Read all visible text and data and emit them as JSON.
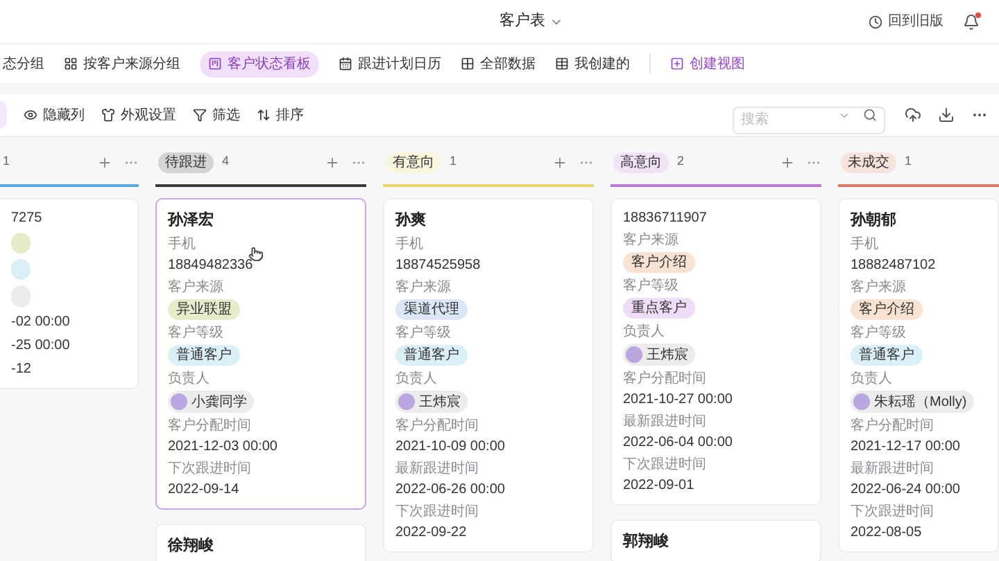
{
  "header": {
    "title": "客户表",
    "back_label": "回到旧版",
    "notification": true
  },
  "views": [
    {
      "label": "态分组",
      "selected": false
    },
    {
      "label": "按客户来源分组",
      "selected": false
    },
    {
      "label": "客户状态看板",
      "selected": true
    },
    {
      "label": "跟进计划日历",
      "selected": false
    },
    {
      "label": "全部数据",
      "selected": false
    },
    {
      "label": "我创建的",
      "selected": false
    }
  ],
  "create_view": "创建视图",
  "toolbar": [
    "隐藏列",
    "外观设置",
    "筛选",
    "排序"
  ],
  "search": {
    "placeholder": "搜索"
  },
  "columns": [
    {
      "count": "1",
      "color": "#5aa9e6",
      "actions": true,
      "cards": [
        {
          "selected": false,
          "fields": [
            {
              "kind": "text",
              "value": "7275"
            },
            {
              "kind": "tag",
              "color": "#e6ecc9"
            },
            {
              "kind": "tag",
              "color": "#dbeff7"
            },
            {
              "kind": "person"
            },
            {
              "kind": "text",
              "value": "-02 00:00"
            },
            {
              "kind": "text",
              "value": "-25 00:00"
            },
            {
              "kind": "text",
              "value": "-12"
            }
          ]
        }
      ]
    },
    {
      "status": "待跟进",
      "count": "4",
      "color": "#3a3a3c",
      "actions": true,
      "cards": [
        {
          "name": "孙泽宏",
          "selected": true,
          "fields": [
            {
              "kind": "text",
              "label": "手机",
              "value": "18849482336"
            },
            {
              "kind": "tag",
              "label": "客户来源",
              "value": "异业联盟",
              "color": "#e6ecc9"
            },
            {
              "kind": "tag",
              "label": "客户等级",
              "value": "普通客户",
              "color": "#dbeff7"
            },
            {
              "kind": "person",
              "label": "负责人",
              "value": "小龚同学"
            },
            {
              "kind": "text",
              "label": "客户分配时间",
              "value": "2021-12-03 00:00"
            },
            {
              "kind": "text",
              "label": "下次跟进时间",
              "value": "2022-09-14"
            }
          ]
        },
        {
          "name": "徐翔峻",
          "selected": false
        }
      ]
    },
    {
      "status": "有意向",
      "count": "1",
      "color": "#e8d66a",
      "actions": true,
      "cards": [
        {
          "name": "孙爽",
          "selected": false,
          "fields": [
            {
              "kind": "text",
              "label": "手机",
              "value": "18874525958"
            },
            {
              "kind": "tag",
              "label": "客户来源",
              "value": "渠道代理",
              "color": "#dbe7f6"
            },
            {
              "kind": "tag",
              "label": "客户等级",
              "value": "普通客户",
              "color": "#dbeff7"
            },
            {
              "kind": "person",
              "label": "负责人",
              "value": "王炜宸"
            },
            {
              "kind": "text",
              "label": "客户分配时间",
              "value": "2021-10-09 00:00"
            },
            {
              "kind": "text",
              "label": "最新跟进时间",
              "value": "2022-06-26 00:00"
            },
            {
              "kind": "text",
              "label": "下次跟进时间",
              "value": "2022-09-22"
            }
          ]
        }
      ]
    },
    {
      "status": "高意向",
      "count": "2",
      "color": "#b97ad9",
      "actions": true,
      "cards": [
        {
          "selected": false,
          "fields": [
            {
              "kind": "text",
              "value": "18836711907"
            },
            {
              "kind": "tag",
              "label": "客户来源",
              "value": "客户介绍",
              "color": "#f8e2d2"
            },
            {
              "kind": "tag",
              "label": "客户等级",
              "value": "重点客户",
              "color": "#efdcf6"
            },
            {
              "kind": "person",
              "label": "负责人",
              "value": "王炜宸"
            },
            {
              "kind": "text",
              "label": "客户分配时间",
              "value": "2021-10-27 00:00"
            },
            {
              "kind": "text",
              "label": "最新跟进时间",
              "value": "2022-06-04 00:00"
            },
            {
              "kind": "text",
              "label": "下次跟进时间",
              "value": "2022-09-01"
            }
          ]
        },
        {
          "name": "郭翔峻",
          "selected": false
        }
      ]
    },
    {
      "status": "未成交",
      "count": "1",
      "color": "#e07a5f",
      "actions": false,
      "cards": [
        {
          "name": "孙朝郁",
          "selected": false,
          "fields": [
            {
              "kind": "text",
              "label": "手机",
              "value": "18882487102"
            },
            {
              "kind": "tag",
              "label": "客户来源",
              "value": "客户介绍",
              "color": "#f8e2d2"
            },
            {
              "kind": "tag",
              "label": "客户等级",
              "value": "普通客户",
              "color": "#dbeff7"
            },
            {
              "kind": "person",
              "label": "负责人",
              "value": "朱耘瑶（Molly)"
            },
            {
              "kind": "text",
              "label": "客户分配时间",
              "value": "2021-12-17 00:00"
            },
            {
              "kind": "text",
              "label": "最新跟进时间",
              "value": "2022-06-24 00:00"
            },
            {
              "kind": "text",
              "label": "下次跟进时间",
              "value": "2022-08-05"
            }
          ]
        }
      ]
    }
  ]
}
